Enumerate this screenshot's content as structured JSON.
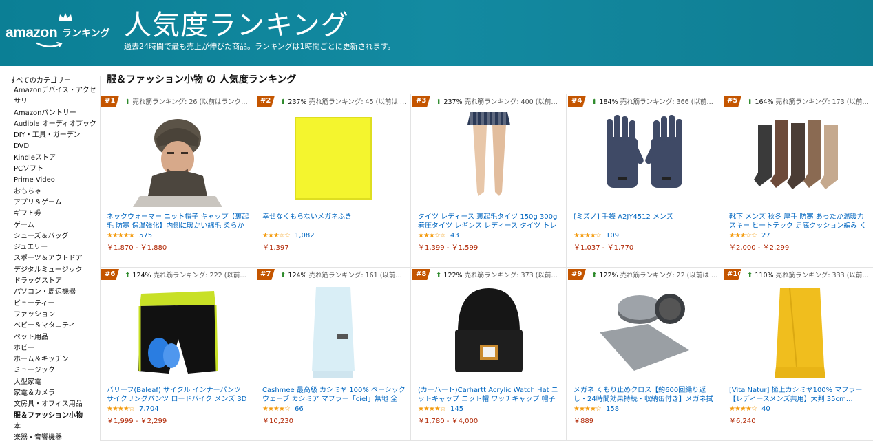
{
  "header": {
    "logo_text": "amazon",
    "logo_sub": "ランキング",
    "title": "人気度ランキング",
    "subtitle": "過去24時間で最も売上が伸びた商品。ランキングは1時間ごとに更新されます。",
    "bg_color": "#138aa1"
  },
  "sidebar": {
    "root": "すべてのカテゴリー",
    "items": [
      "Amazonデバイス・アクセサリ",
      "Amazonパントリー",
      "Audible オーディオブック",
      "DIY・工具・ガーデン",
      "DVD",
      "Kindleストア",
      "PCソフト",
      "Prime Video",
      "おもちゃ",
      "アプリ＆ゲーム",
      "ギフト券",
      "ゲーム",
      "シューズ＆バッグ",
      "ジュエリー",
      "スポーツ＆アウトドア",
      "デジタルミュージック",
      "ドラッグストア",
      "パソコン・周辺機器",
      "ビューティー",
      "ファッション",
      "ベビー＆マタニティ",
      "ペット用品",
      "ホビー",
      "ホーム＆キッチン",
      "ミュージック",
      "大型家電",
      "家電＆カメラ",
      "文房具・オフィス用品",
      "服＆ファッション小物",
      "本",
      "楽器・音響機器"
    ],
    "active": "服＆ファッション小物"
  },
  "main": {
    "title": "服＆ファッション小物 の 人気度ランキング"
  },
  "products": [
    {
      "rank": "#1",
      "pct": "",
      "info": "売れ筋ランキング: 26 (以前はランク…",
      "title": "ネックウォーマー ニット帽子 キャップ【裏起毛 防寒 保温強化】内側に暖かい綿毛 柔らかい 伸…",
      "stars": "★★★★★",
      "reviews": "575",
      "price": "￥1,870 - ￥1,880",
      "image": "beanie-model-image"
    },
    {
      "rank": "#2",
      "pct": "237%",
      "info": "売れ筋ランキング: 45 (以前は 1…",
      "title": "幸せなくもらないメガネふき",
      "stars": "★★★☆☆",
      "reviews": "1,082",
      "price": "￥1,397",
      "image": "yellow-cloth-image"
    },
    {
      "rank": "#3",
      "pct": "237%",
      "info": "売れ筋ランキング: 400 (以前は …",
      "title": "タイツ レディース 裏起毛タイツ 150g 300g 着圧タイツ レギンス レディース タイツ トレンカ…",
      "stars": "★★★☆☆",
      "reviews": "43",
      "price": "￥1,399 - ￥1,599",
      "image": "tights-image"
    },
    {
      "rank": "#4",
      "pct": "184%",
      "info": "売れ筋ランキング: 366 (以前は …",
      "title": "[ミズノ] 手袋 A2JY4512 メンズ",
      "stars": "★★★★☆",
      "reviews": "109",
      "price": "￥1,037 - ￥1,770",
      "image": "gloves-image"
    },
    {
      "rank": "#5",
      "pct": "164%",
      "info": "売れ筋ランキング: 173 (以前は …",
      "title": "靴下 メンズ 秋冬 厚手 防寒 あったか温暖力 スキー ヒートテック 足底クッション編み くつした…",
      "stars": "★★★☆☆",
      "reviews": "27",
      "price": "￥2,000 - ￥2,299",
      "image": "socks-image"
    },
    {
      "rank": "#6",
      "pct": "124%",
      "info": "売れ筋ランキング: 222 (以前は …",
      "title": "バリーフ(Baleaf) サイクル インナーパンツ サイクリングパンツ ロードバイク メンズ 3Dゲルパ…",
      "stars": "★★★★☆",
      "reviews": "7,704",
      "price": "￥1,999 - ￥2,299",
      "image": "cycling-shorts-image"
    },
    {
      "rank": "#7",
      "pct": "124%",
      "info": "売れ筋ランキング: 161 (以前は …",
      "title": "Cashmee 最高級 カシミヤ 100% ベーシックウェーブ カシミア マフラー「ciel」無地 全19色",
      "stars": "★★★★☆",
      "reviews": "66",
      "price": "￥10,230",
      "image": "light-blue-scarf-image"
    },
    {
      "rank": "#8",
      "pct": "122%",
      "info": "売れ筋ランキング: 373 (以前は …",
      "title": "(カーハート)Carhartt Acrylic Watch Hat ニットキャップ ニット帽 ワッチキャップ 帽子 ビーニー",
      "stars": "★★★★☆",
      "reviews": "145",
      "price": "￥1,780 - ￥4,000",
      "image": "black-beanie-image"
    },
    {
      "rank": "#9",
      "pct": "122%",
      "info": "売れ筋ランキング: 22 (以前は 49)",
      "title": "メガネ くもり止めクロス【約600回繰り返し・24時間効果持続・収納缶付き】メガネ拭き くり返…",
      "stars": "★★★★☆",
      "reviews": "158",
      "price": "￥889",
      "image": "anti-fog-cloth-image"
    },
    {
      "rank": "#10",
      "pct": "110%",
      "info": "売れ筋ランキング: 333 (以前…",
      "title": "[Vita Natur] 極上カシミヤ100% マフラー【レディースメンズ共用】大判 35cm…",
      "stars": "★★★★☆",
      "reviews": "40",
      "price": "￥6,240",
      "image": "yellow-scarf-image"
    }
  ]
}
